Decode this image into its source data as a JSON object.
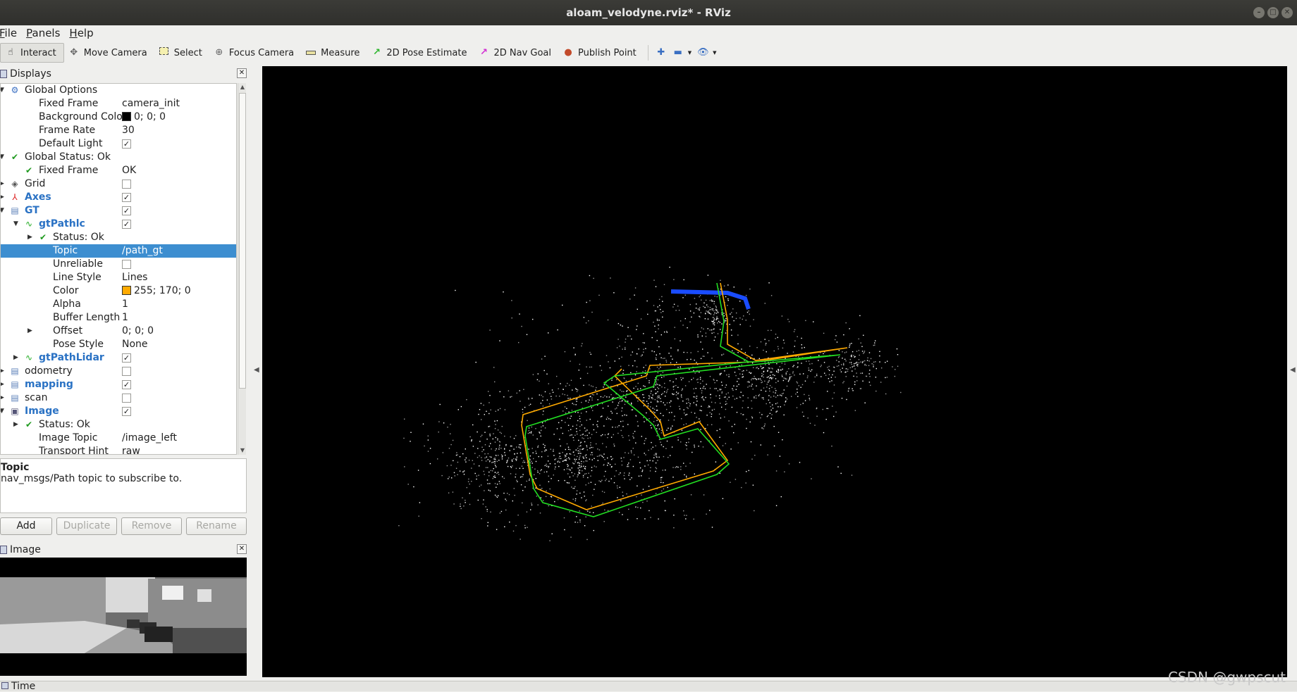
{
  "window": {
    "title": "aloam_velodyne.rviz* - RViz"
  },
  "menu": [
    "File",
    "Panels",
    "Help"
  ],
  "toolbar": [
    {
      "label": "Interact",
      "icon": "hand-icon",
      "active": true
    },
    {
      "label": "Move Camera",
      "icon": "move-camera-icon"
    },
    {
      "label": "Select",
      "icon": "select-icon"
    },
    {
      "label": "Focus Camera",
      "icon": "focus-camera-icon"
    },
    {
      "label": "Measure",
      "icon": "ruler-icon"
    },
    {
      "label": "2D Pose Estimate",
      "icon": "green-arrow-icon"
    },
    {
      "label": "2D Nav Goal",
      "icon": "magenta-arrow-icon"
    },
    {
      "label": "Publish Point",
      "icon": "map-pin-icon"
    }
  ],
  "displays_panel": {
    "title": "Displays",
    "rows": [
      {
        "indent": 0,
        "expander": "open",
        "icon": "gear-icon",
        "label": "Global Options"
      },
      {
        "indent": 1,
        "label": "Fixed Frame",
        "value": "camera_init"
      },
      {
        "indent": 1,
        "label": "Background Color",
        "value": "0; 0; 0",
        "swatch": "#000000"
      },
      {
        "indent": 1,
        "label": "Frame Rate",
        "value": "30"
      },
      {
        "indent": 1,
        "label": "Default Light",
        "check": true
      },
      {
        "indent": 0,
        "expander": "open",
        "icon": "check-icon",
        "label": "Global Status: Ok"
      },
      {
        "indent": 1,
        "icon": "check-icon",
        "label": "Fixed Frame",
        "value": "OK"
      },
      {
        "indent": 0,
        "expander": "closed",
        "icon": "grid-icon",
        "label": "Grid",
        "check": false
      },
      {
        "indent": 0,
        "expander": "closed",
        "icon": "axes-icon",
        "label": "Axes",
        "check": true,
        "bold": true
      },
      {
        "indent": 0,
        "expander": "open",
        "icon": "folder-icon",
        "label": "GT",
        "check": true,
        "bold": true
      },
      {
        "indent": 1,
        "expander": "open",
        "icon": "path-icon",
        "label": "gtPathlc",
        "check": true,
        "bold": true
      },
      {
        "indent": 2,
        "expander": "closed",
        "icon": "check-icon",
        "label": "Status: Ok"
      },
      {
        "indent": 2,
        "label": "Topic",
        "value": "/path_gt",
        "selected": true
      },
      {
        "indent": 2,
        "label": "Unreliable",
        "check": false
      },
      {
        "indent": 2,
        "label": "Line Style",
        "value": "Lines"
      },
      {
        "indent": 2,
        "label": "Color",
        "value": "255; 170; 0",
        "swatch": "#ffaa00"
      },
      {
        "indent": 2,
        "label": "Alpha",
        "value": "1"
      },
      {
        "indent": 2,
        "label": "Buffer Length",
        "value": "1"
      },
      {
        "indent": 2,
        "expander": "closed",
        "label": "Offset",
        "value": "0; 0; 0"
      },
      {
        "indent": 2,
        "label": "Pose Style",
        "value": "None"
      },
      {
        "indent": 1,
        "expander": "closed",
        "icon": "path-icon",
        "label": "gtPathLidar",
        "check": true,
        "bold": true
      },
      {
        "indent": 0,
        "expander": "closed",
        "icon": "folder-icon",
        "label": "odometry",
        "check": false
      },
      {
        "indent": 0,
        "expander": "closed",
        "icon": "folder-icon",
        "label": "mapping",
        "check": true,
        "bold": true
      },
      {
        "indent": 0,
        "expander": "closed",
        "icon": "folder-icon",
        "label": "scan",
        "check": false
      },
      {
        "indent": 0,
        "expander": "open",
        "icon": "image-icon",
        "label": "Image",
        "check": true,
        "bold": true
      },
      {
        "indent": 1,
        "expander": "closed",
        "icon": "check-icon",
        "label": "Status: Ok"
      },
      {
        "indent": 1,
        "label": "Image Topic",
        "value": "/image_left"
      },
      {
        "indent": 1,
        "label": "Transport Hint",
        "value": "raw"
      }
    ]
  },
  "description": {
    "title": "Topic",
    "text": "nav_msgs/Path topic to subscribe to."
  },
  "buttons": {
    "add": "Add",
    "duplicate": "Duplicate",
    "remove": "Remove",
    "rename": "Rename"
  },
  "image_panel": {
    "title": "Image"
  },
  "time_panel": {
    "title": "Time"
  },
  "watermark": "CSDN @gwpscut"
}
